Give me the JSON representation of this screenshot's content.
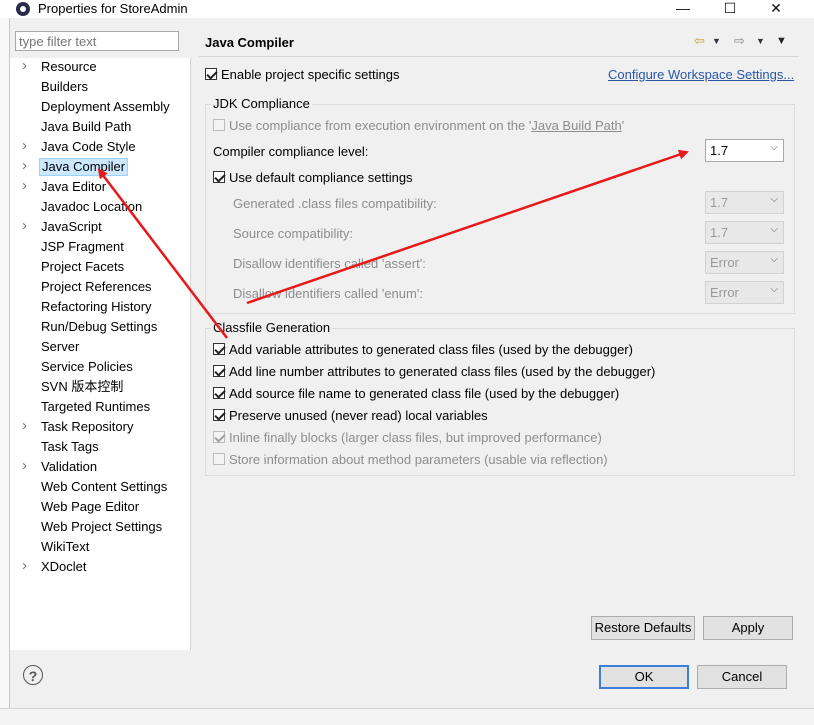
{
  "window": {
    "title": "Properties for StoreAdmin",
    "controls": [
      "—",
      "☐",
      "✕"
    ]
  },
  "filter": {
    "placeholder": "type filter text"
  },
  "tree": {
    "items": [
      {
        "label": "Resource",
        "expandable": true
      },
      {
        "label": "Builders",
        "expandable": false
      },
      {
        "label": "Deployment Assembly",
        "expandable": false
      },
      {
        "label": "Java Build Path",
        "expandable": false
      },
      {
        "label": "Java Code Style",
        "expandable": true
      },
      {
        "label": "Java Compiler",
        "expandable": true,
        "selected": true
      },
      {
        "label": "Java Editor",
        "expandable": true
      },
      {
        "label": "Javadoc Location",
        "expandable": false
      },
      {
        "label": "JavaScript",
        "expandable": true
      },
      {
        "label": "JSP Fragment",
        "expandable": false
      },
      {
        "label": "Project Facets",
        "expandable": false
      },
      {
        "label": "Project References",
        "expandable": false
      },
      {
        "label": "Refactoring History",
        "expandable": false
      },
      {
        "label": "Run/Debug Settings",
        "expandable": false
      },
      {
        "label": "Server",
        "expandable": false
      },
      {
        "label": "Service Policies",
        "expandable": false
      },
      {
        "label": "SVN 版本控制",
        "expandable": false
      },
      {
        "label": "Targeted Runtimes",
        "expandable": false
      },
      {
        "label": "Task Repository",
        "expandable": true
      },
      {
        "label": "Task Tags",
        "expandable": false
      },
      {
        "label": "Validation",
        "expandable": true
      },
      {
        "label": "Web Content Settings",
        "expandable": false
      },
      {
        "label": "Web Page Editor",
        "expandable": false
      },
      {
        "label": "Web Project Settings",
        "expandable": false
      },
      {
        "label": "WikiText",
        "expandable": false
      },
      {
        "label": "XDoclet",
        "expandable": true
      }
    ]
  },
  "panel": {
    "title": "Java Compiler",
    "enable_project": "Enable project specific settings",
    "configure_link": "Configure Workspace Settings...",
    "jdk": {
      "title": "JDK Compliance",
      "use_compliance_pre": "Use compliance from execution environment on the '",
      "use_compliance_link": "Java Build Path",
      "use_compliance_post": "'",
      "compliance_level_label": "Compiler compliance level:",
      "compliance_level_value": "1.7",
      "use_default": "Use default compliance settings",
      "generated_label": "Generated .class files compatibility:",
      "generated_value": "1.7",
      "source_label": "Source compatibility:",
      "source_value": "1.7",
      "assert_label": "Disallow identifiers called 'assert':",
      "assert_value": "Error",
      "enum_label": "Disallow identifiers called 'enum':",
      "enum_value": "Error"
    },
    "classfile": {
      "title": "Classfile Generation",
      "options": [
        {
          "label": "Add variable attributes to generated class files (used by the debugger)",
          "checked": true,
          "disabled": false
        },
        {
          "label": "Add line number attributes to generated class files (used by the debugger)",
          "checked": true,
          "disabled": false
        },
        {
          "label": "Add source file name to generated class file (used by the debugger)",
          "checked": true,
          "disabled": false
        },
        {
          "label": "Preserve unused (never read) local variables",
          "checked": true,
          "disabled": false
        },
        {
          "label": "Inline finally blocks (larger class files, but improved performance)",
          "checked": true,
          "disabled": true
        },
        {
          "label": "Store information about method parameters (usable via reflection)",
          "checked": false,
          "disabled": true
        }
      ]
    },
    "restore_defaults": "Restore Defaults",
    "apply": "Apply"
  },
  "footer": {
    "help": "?",
    "ok": "OK",
    "cancel": "Cancel"
  },
  "colors": {
    "annotation_arrow": "#e8191a",
    "selection_bg": "#cce8ff",
    "link": "#2a56a8"
  }
}
